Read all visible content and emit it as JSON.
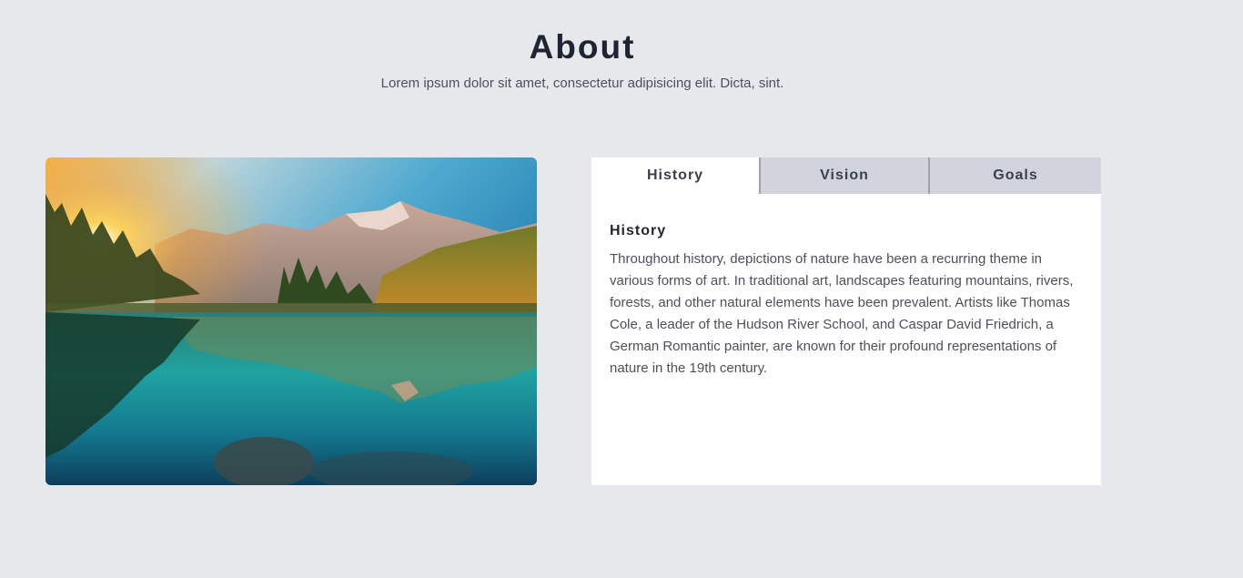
{
  "header": {
    "title": "About",
    "subtitle": "Lorem ipsum dolor sit amet, consectetur adipisicing elit. Dicta, sint."
  },
  "tabs": [
    {
      "label": "History",
      "active": true
    },
    {
      "label": "Vision",
      "active": false
    },
    {
      "label": "Goals",
      "active": false
    }
  ],
  "content": {
    "title": "History",
    "body": "Throughout history, depictions of nature have been a recurring theme in various forms of art. In traditional art, landscapes featuring mountains, rivers, forests, and other natural elements have been prevalent. Artists like Thomas Cole, a leader of the Hudson River School, and Caspar David Friedrich, a German Romantic painter, are known for their profound representations of nature in the 19th century."
  },
  "colors": {
    "background": "#e7e8ec",
    "tab_inactive": "#d1d4dc",
    "tab_active": "#ffffff",
    "title_text": "#1f2433",
    "body_text": "#4b5060"
  }
}
